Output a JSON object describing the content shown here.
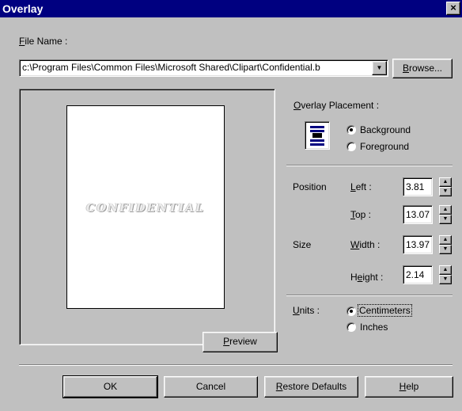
{
  "window": {
    "title": "Overlay",
    "close_glyph": "×"
  },
  "file": {
    "label": "File Name :",
    "value": "c:\\Program Files\\Common Files\\Microsoft Shared\\Clipart\\Confidential.b",
    "browse_label": "Browse..."
  },
  "preview": {
    "watermark": "CONFIDENTIAL",
    "button_label": "Preview"
  },
  "placement": {
    "label": "Overlay Placement :",
    "options": [
      {
        "label": "Background",
        "checked": true
      },
      {
        "label": "Foreground",
        "checked": false
      }
    ]
  },
  "position": {
    "group_label": "Position",
    "left": {
      "label": "Left :",
      "value": "3.81"
    },
    "top": {
      "label": "Top :",
      "value": "13.07"
    }
  },
  "size": {
    "group_label": "Size",
    "width": {
      "label": "Width :",
      "value": "13.97"
    },
    "height": {
      "label": "Height :",
      "value": "2.14"
    }
  },
  "units": {
    "label": "Units :",
    "options": [
      {
        "label": "Centimeters",
        "checked": true
      },
      {
        "label": "Inches",
        "checked": false
      }
    ]
  },
  "buttons": {
    "ok": "OK",
    "cancel": "Cancel",
    "restore": "Restore Defaults",
    "help": "Help"
  }
}
